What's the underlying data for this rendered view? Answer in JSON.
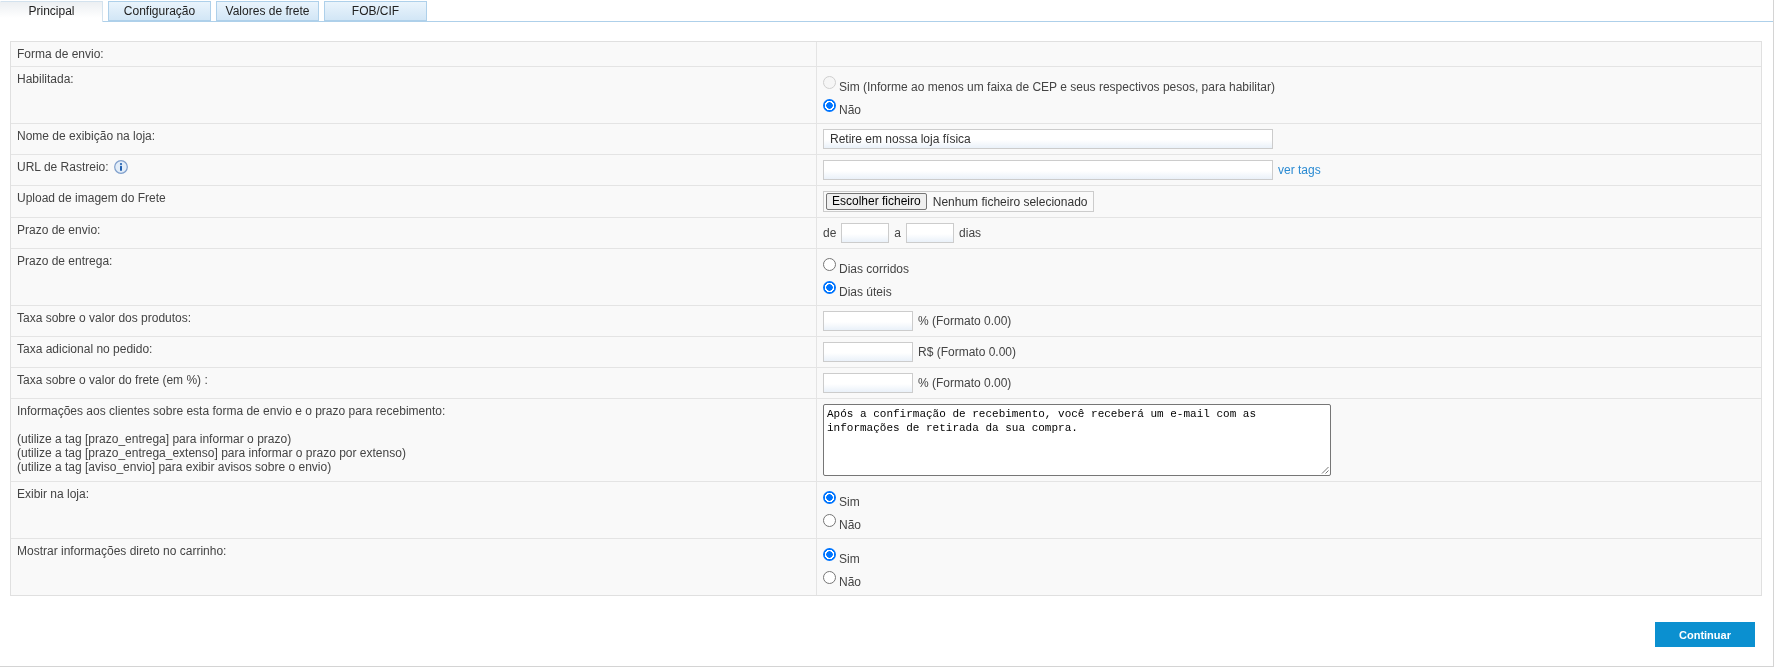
{
  "tabs": [
    {
      "label": "Principal",
      "selected": true
    },
    {
      "label": "Configuração",
      "selected": false
    },
    {
      "label": "Valores de frete",
      "selected": false
    },
    {
      "label": "FOB/CIF",
      "selected": false
    }
  ],
  "form": {
    "rows": [
      {
        "label": "Forma de envio:",
        "kind": "empty"
      },
      {
        "label": "Habilitada:",
        "kind": "radio",
        "options": [
          {
            "label": "Sim (Informe ao menos um faixa de CEP e seus respectivos pesos, para habilitar)",
            "selected": false,
            "disabled": true
          },
          {
            "label": "Não",
            "selected": true,
            "disabled": false
          }
        ]
      },
      {
        "label": "Nome de exibição na loja:",
        "kind": "text",
        "value": "Retire em nossa loja física"
      },
      {
        "label": "URL de Rastreio:",
        "info_icon": true,
        "kind": "text",
        "link": "ver tags"
      },
      {
        "label": "Upload de imagem do Frete",
        "kind": "file",
        "button": "Escolher ficheiro",
        "status": "Nenhum ficheiro selecionado"
      },
      {
        "label": "Prazo de envio:",
        "kind": "range",
        "prefix": "de",
        "middle": "a",
        "suffix": "dias"
      },
      {
        "label": "Prazo de entrega:",
        "kind": "radio",
        "options": [
          {
            "label": "Dias corridos",
            "selected": false
          },
          {
            "label": "Dias úteis",
            "selected": true
          }
        ]
      },
      {
        "label": "Taxa sobre o valor dos produtos:",
        "kind": "amount",
        "suffix": "% (Formato 0.00)"
      },
      {
        "label": "Taxa adicional no pedido:",
        "kind": "amount",
        "suffix": "R$ (Formato 0.00)"
      },
      {
        "label": "Taxa sobre o valor do frete (em %) :",
        "kind": "amount",
        "suffix": "% (Formato 0.00)"
      },
      {
        "label": "Informações aos clientes sobre esta forma de envio e o prazo para recebimento:",
        "notes": [
          "(utilize a tag [prazo_entrega] para informar o prazo)",
          "(utilize a tag [prazo_entrega_extenso] para informar o prazo por extenso)",
          "(utilize a tag [aviso_envio] para exibir avisos sobre o envio)"
        ],
        "kind": "textarea",
        "value": "Após a confirmação de recebimento, você receberá um e-mail com as informações de retirada da sua compra."
      },
      {
        "label": "Exibir na loja:",
        "kind": "radio",
        "options": [
          {
            "label": "Sim",
            "selected": true
          },
          {
            "label": "Não",
            "selected": false
          }
        ]
      },
      {
        "label": "Mostrar informações direto no carrinho:",
        "kind": "radio",
        "options": [
          {
            "label": "Sim",
            "selected": true
          },
          {
            "label": "Não",
            "selected": false
          }
        ]
      }
    ]
  },
  "continue_button": "Continuar"
}
